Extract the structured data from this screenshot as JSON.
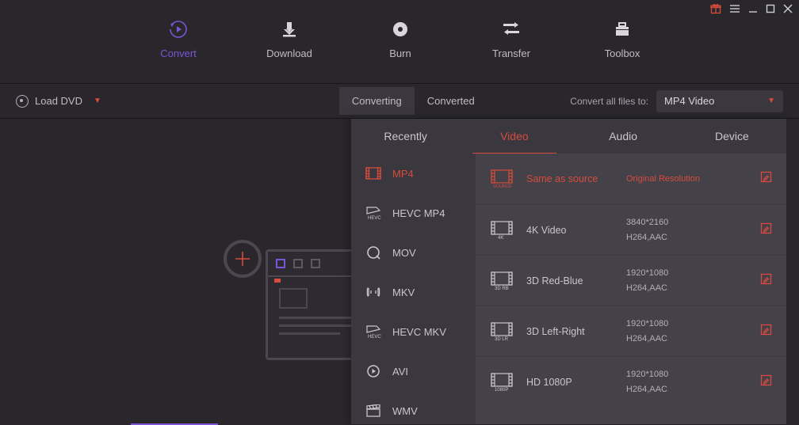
{
  "nav": {
    "items": [
      {
        "label": "Convert"
      },
      {
        "label": "Download"
      },
      {
        "label": "Burn"
      },
      {
        "label": "Transfer"
      },
      {
        "label": "Toolbox"
      }
    ]
  },
  "subbar": {
    "load_dvd": "Load DVD",
    "tabs": [
      {
        "label": "Converting"
      },
      {
        "label": "Converted"
      }
    ],
    "convert_all_label": "Convert all files to:",
    "convert_all_value": "MP4 Video"
  },
  "panel": {
    "tabs": [
      {
        "label": "Recently"
      },
      {
        "label": "Video"
      },
      {
        "label": "Audio"
      },
      {
        "label": "Device"
      }
    ],
    "formats": [
      {
        "label": "MP4"
      },
      {
        "label": "HEVC MP4"
      },
      {
        "label": "MOV"
      },
      {
        "label": "MKV"
      },
      {
        "label": "HEVC MKV"
      },
      {
        "label": "AVI"
      },
      {
        "label": "WMV"
      }
    ],
    "presets": [
      {
        "name": "Same as source",
        "res": "Original Resolution",
        "codec": ""
      },
      {
        "name": "4K Video",
        "res": "3840*2160",
        "codec": "H264,AAC"
      },
      {
        "name": "3D Red-Blue",
        "res": "1920*1080",
        "codec": "H264,AAC"
      },
      {
        "name": "3D Left-Right",
        "res": "1920*1080",
        "codec": "H264,AAC"
      },
      {
        "name": "HD 1080P",
        "res": "1920*1080",
        "codec": "H264,AAC"
      }
    ]
  }
}
